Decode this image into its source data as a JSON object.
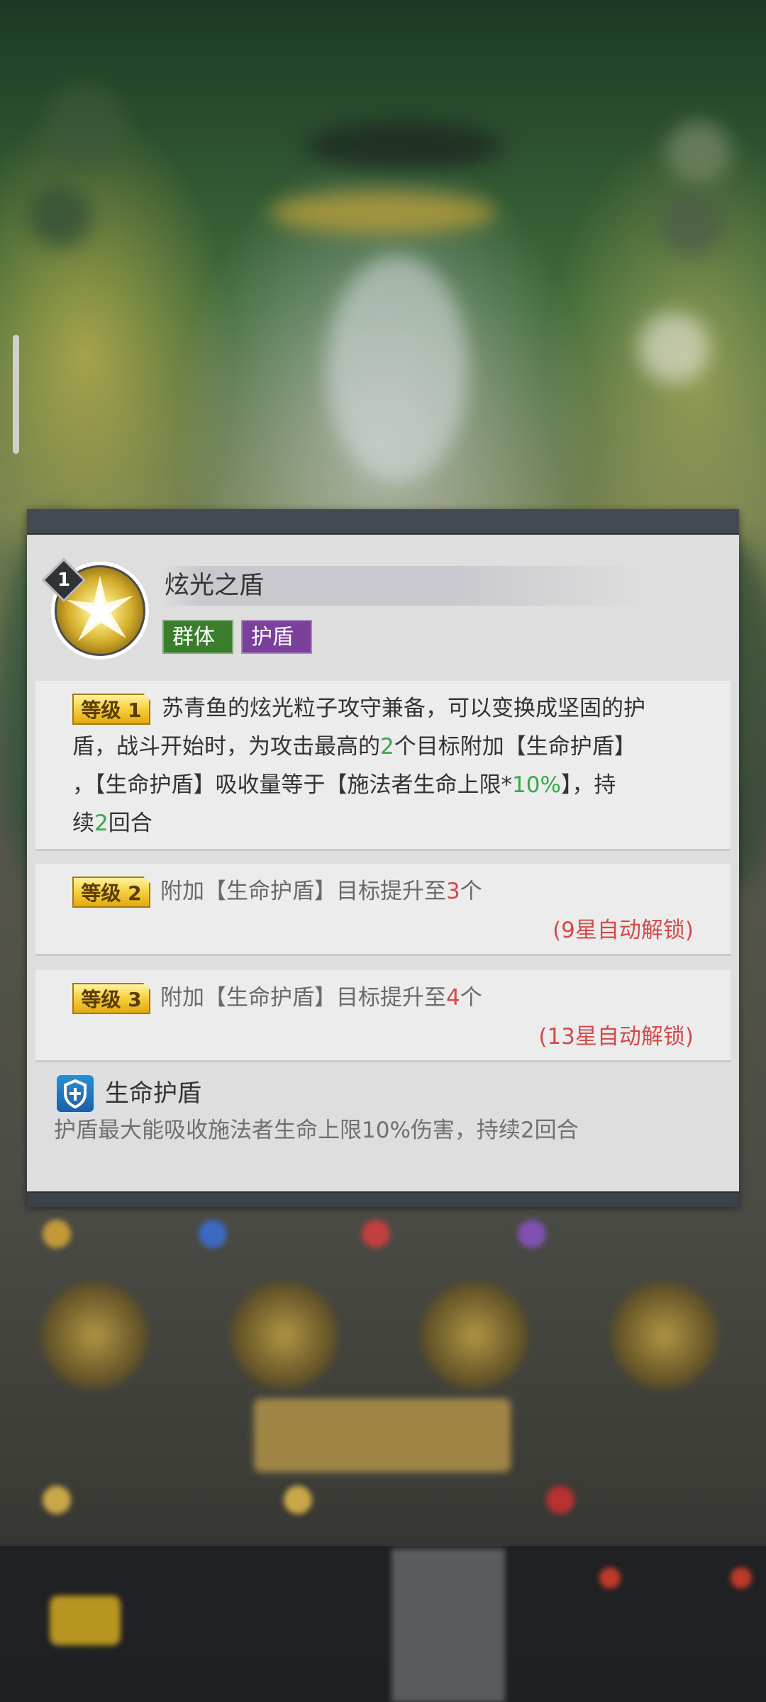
{
  "skill": {
    "level": "1",
    "name": "炫光之盾",
    "tags": [
      "群体",
      "护盾"
    ]
  },
  "levels": [
    {
      "badge": "等级 1",
      "lines": [
        [
          {
            "t": "苏青鱼的炫光粒子攻守兼备，可以变换成坚固的护",
            "c": "n"
          }
        ],
        [
          {
            "t": "盾，战斗开始时，为攻击最高的",
            "c": "n"
          },
          {
            "t": "2",
            "c": "g"
          },
          {
            "t": "个目标附加【生命护盾】",
            "c": "n"
          }
        ],
        [
          {
            "t": "，【生命护盾】吸收量等于【施法者生命上限*",
            "c": "n"
          },
          {
            "t": "10%",
            "c": "g"
          },
          {
            "t": "】，持",
            "c": "n"
          }
        ],
        [
          {
            "t": "续",
            "c": "n"
          },
          {
            "t": "2",
            "c": "g"
          },
          {
            "t": "回合",
            "c": "n"
          }
        ]
      ]
    },
    {
      "badge": "等级 2",
      "lines": [
        [
          {
            "t": "附加【生命护盾】目标提升至",
            "c": "d"
          },
          {
            "t": "3",
            "c": "r"
          },
          {
            "t": "个",
            "c": "d"
          }
        ]
      ],
      "unlock": "(9星自动解锁)"
    },
    {
      "badge": "等级 3",
      "lines": [
        [
          {
            "t": "附加【生命护盾】目标提升至",
            "c": "d"
          },
          {
            "t": "4",
            "c": "r"
          },
          {
            "t": "个",
            "c": "d"
          }
        ]
      ],
      "unlock": "(13星自动解锁)"
    }
  ],
  "buff": {
    "icon": "shield-buff-icon",
    "name": "生命护盾",
    "description": "护盾最大能吸收施法者生命上限10%伤害，持续2回合"
  },
  "colors": {
    "highlight_green": "#35a94a",
    "highlight_red": "#d44a4a",
    "tag_group": "#3a7d2d",
    "tag_shield": "#7b3f9c"
  }
}
